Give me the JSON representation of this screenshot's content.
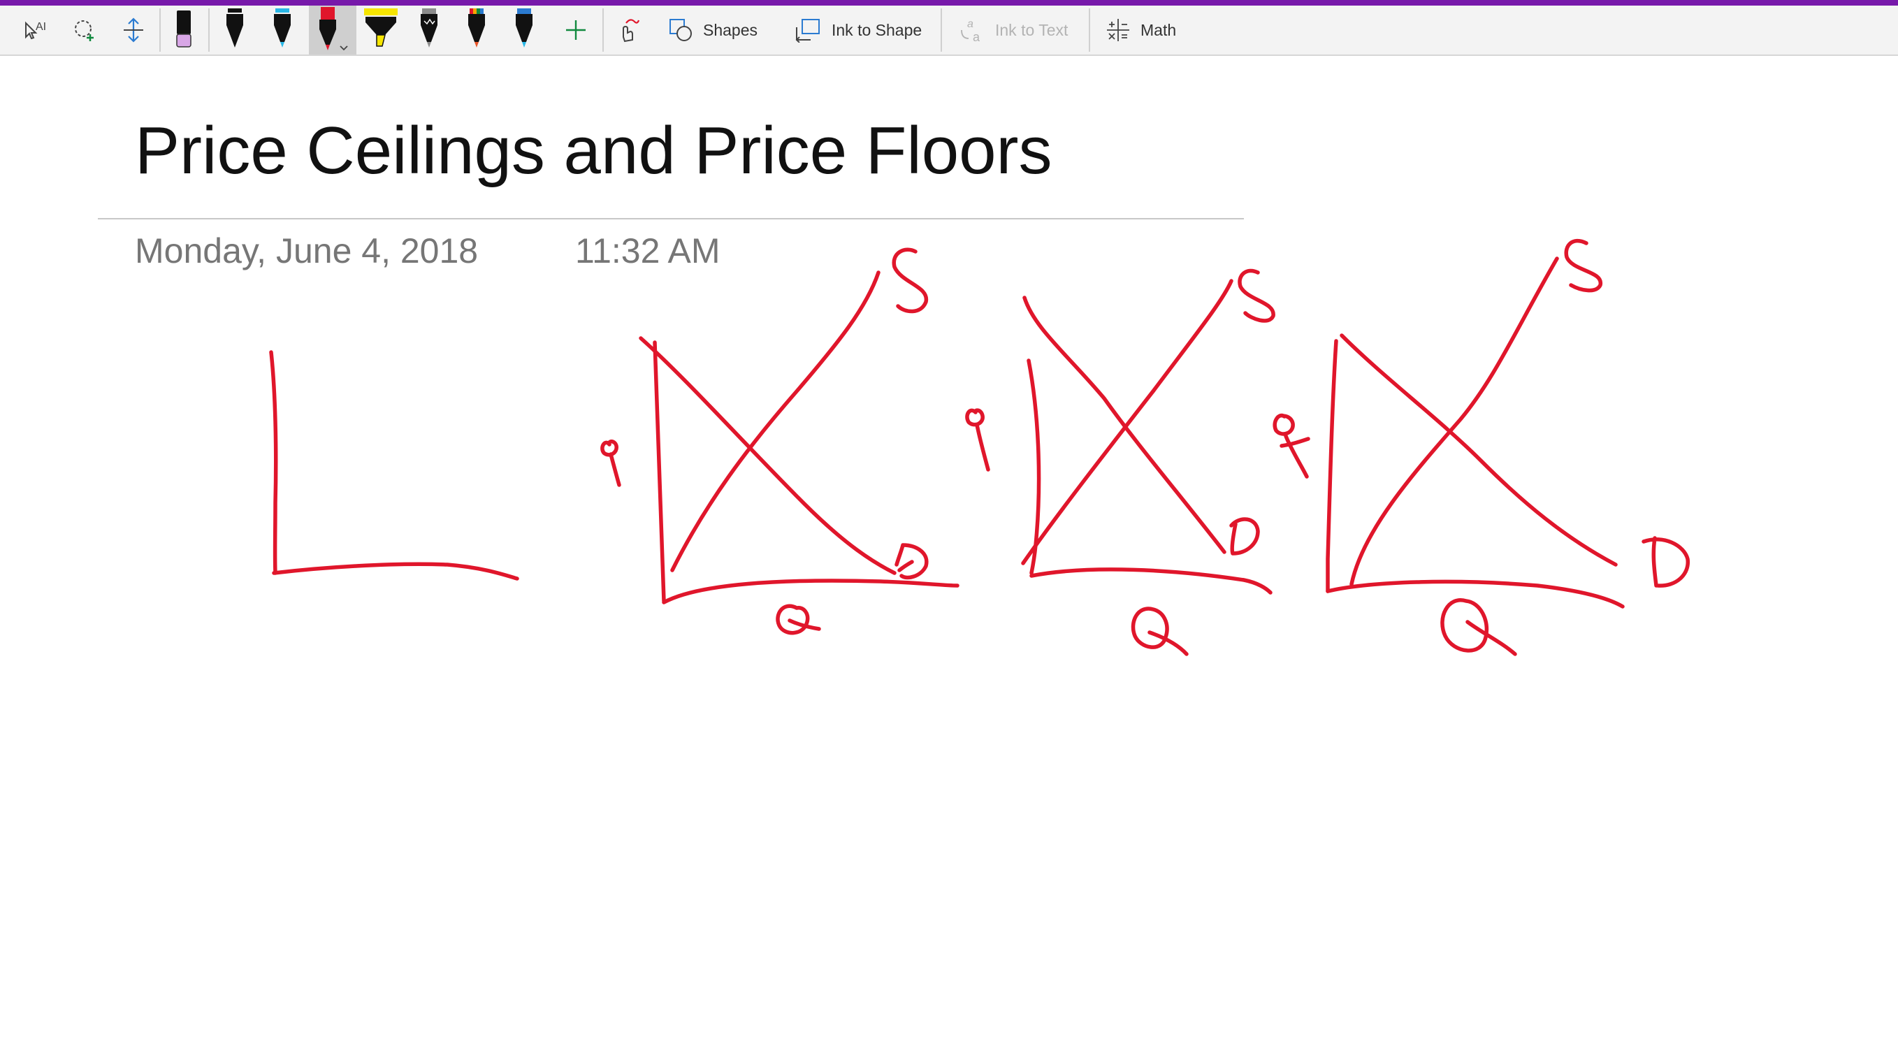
{
  "toolbar": {
    "accent_color": "#7719aa",
    "ink_color": "#e0162b",
    "tools": [
      {
        "name": "type-select-icon"
      },
      {
        "name": "lasso-select-icon"
      },
      {
        "name": "add-space-icon"
      },
      {
        "name": "eraser-icon"
      }
    ],
    "pens": [
      {
        "name": "pen-black",
        "color": "#111111"
      },
      {
        "name": "pen-cyan",
        "color": "#2ab7e6"
      },
      {
        "name": "pen-red",
        "color": "#e0162b",
        "selected": true
      },
      {
        "name": "highlighter-yellow",
        "color": "#f6e500"
      },
      {
        "name": "pen-galaxy",
        "color": "#8c8c8c"
      },
      {
        "name": "pen-rainbow",
        "color": "#e8562a"
      },
      {
        "name": "pen-ocean",
        "color": "#2b7bd1"
      }
    ],
    "add_pen_icon": "plus-icon",
    "ink_replay_icon": "ink-replay-icon",
    "shapes_label": "Shapes",
    "ink_to_shape_label": "Ink to Shape",
    "ink_to_text_label": "Ink to Text",
    "math_label": "Math"
  },
  "page": {
    "title": "Price Ceilings and Price Floors",
    "date": "Monday, June 4, 2018",
    "time": "11:32 AM"
  }
}
